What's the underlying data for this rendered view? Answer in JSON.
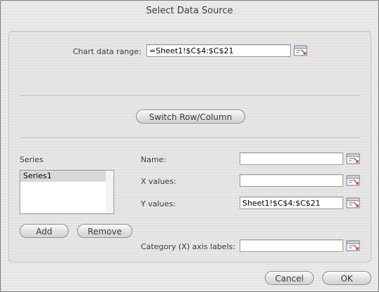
{
  "dialog": {
    "title": "Select Data Source",
    "chart_data_range_label": "Chart data range:",
    "chart_data_range_value": "=Sheet1!$C$4:$C$21",
    "switch_button": "Switch Row/Column",
    "series_heading": "Series",
    "series_items": [
      "Series1"
    ],
    "name_label": "Name:",
    "name_value": "",
    "x_values_label": "X values:",
    "x_values_value": "",
    "y_values_label": "Y values:",
    "y_values_value": "Sheet1!$C$4:$C$21",
    "category_label": "Category (X) axis labels:",
    "category_value": "",
    "add_button": "Add",
    "remove_button": "Remove",
    "cancel_button": "Cancel",
    "ok_button": "OK"
  },
  "icons": {
    "range_picker": "range-picker-icon"
  }
}
